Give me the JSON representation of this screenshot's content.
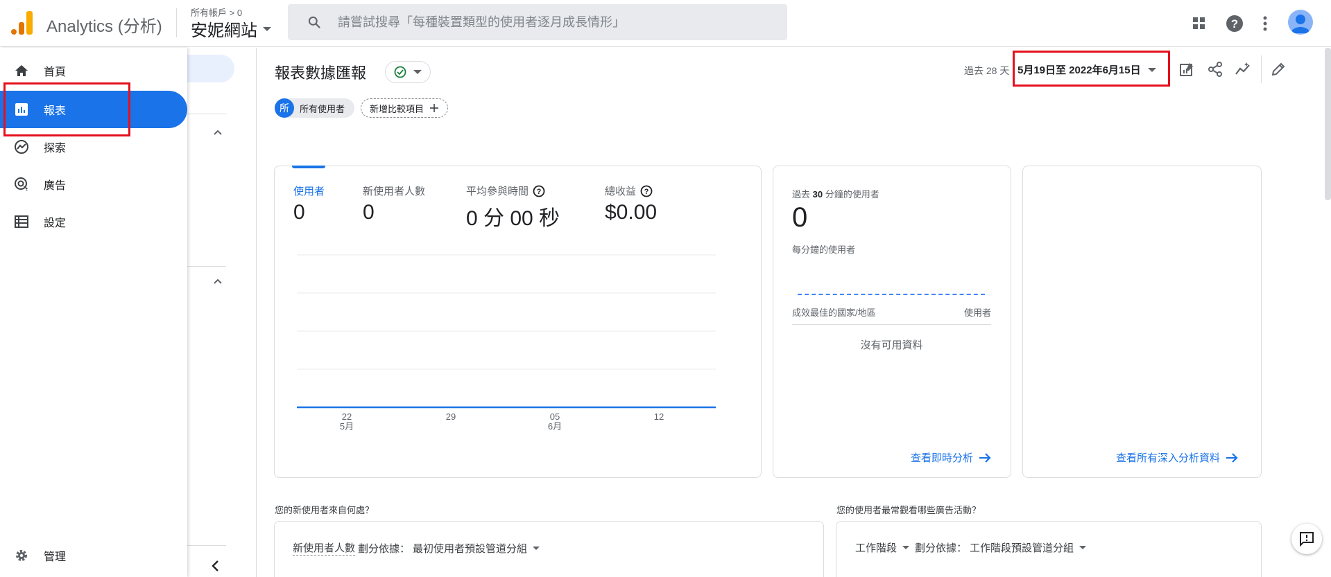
{
  "header": {
    "app_title": "Analytics (分析)",
    "account_crumb": "所有帳戶 > 0",
    "property_name": "安妮網站",
    "search_placeholder": "請嘗試搜尋「每種裝置類型的使用者逐月成長情形」",
    "icons": [
      "apps-grid-icon",
      "help-icon",
      "more-vert-icon",
      "account-avatar"
    ]
  },
  "sidebar": {
    "items": [
      {
        "label": "首頁",
        "icon": "home-icon"
      },
      {
        "label": "報表",
        "icon": "reports-icon",
        "active": true
      },
      {
        "label": "探索",
        "icon": "explore-icon"
      },
      {
        "label": "廣告",
        "icon": "advertising-icon"
      },
      {
        "label": "設定",
        "icon": "configure-icon"
      }
    ],
    "admin_label": "管理"
  },
  "main": {
    "title": "報表數據匯報",
    "range_label": "過去 28 天",
    "range_value": "5月19日至 2022年6月15日",
    "segment_badge": "所",
    "segment_label": "所有使用者",
    "add_compare_label": "新增比較項目"
  },
  "overview_card": {
    "kpis": [
      {
        "label": "使用者",
        "value": "0",
        "active": true
      },
      {
        "label": "新使用者人數",
        "value": "0"
      },
      {
        "label": "平均參與時間",
        "value": "0 分 00 秒",
        "help": true
      },
      {
        "label": "總收益",
        "value": "$0.00",
        "help": true
      }
    ]
  },
  "chart_data": {
    "type": "line",
    "x_ticks": [
      {
        "day": "22",
        "month": "5月"
      },
      {
        "day": "29",
        "month": ""
      },
      {
        "day": "05",
        "month": "6月"
      },
      {
        "day": "12",
        "month": ""
      }
    ],
    "series": [
      {
        "values": [
          0,
          0,
          0,
          0
        ]
      }
    ],
    "grid": true
  },
  "realtime_card": {
    "title_prefix": "過去",
    "title_number": "30",
    "title_suffix": "分鐘的使用者",
    "value": "0",
    "sub_label": "每分鐘的使用者",
    "col_left": "成效最佳的國家/地區",
    "col_right": "使用者",
    "empty_text": "沒有可用資料",
    "link": "查看即時分析"
  },
  "insights_card": {
    "link": "查看所有深入分析資料"
  },
  "bottom": {
    "left_question": "您的新使用者來自何處？",
    "left_metric": "新使用者人數",
    "left_dim_prefix": "劃分依據：",
    "left_dim": "最初使用者預設管道分組",
    "right_question": "您的使用者最常觀看哪些廣告活動？",
    "right_metric": "工作階段",
    "right_dim_prefix": "劃分依據：",
    "right_dim": "工作階段預設管道分組"
  },
  "colors": {
    "accent": "#1a73e8",
    "highlight_box": "#e5101d",
    "logo_orange": "#f9ab00",
    "logo_dark_orange": "#e37400"
  }
}
